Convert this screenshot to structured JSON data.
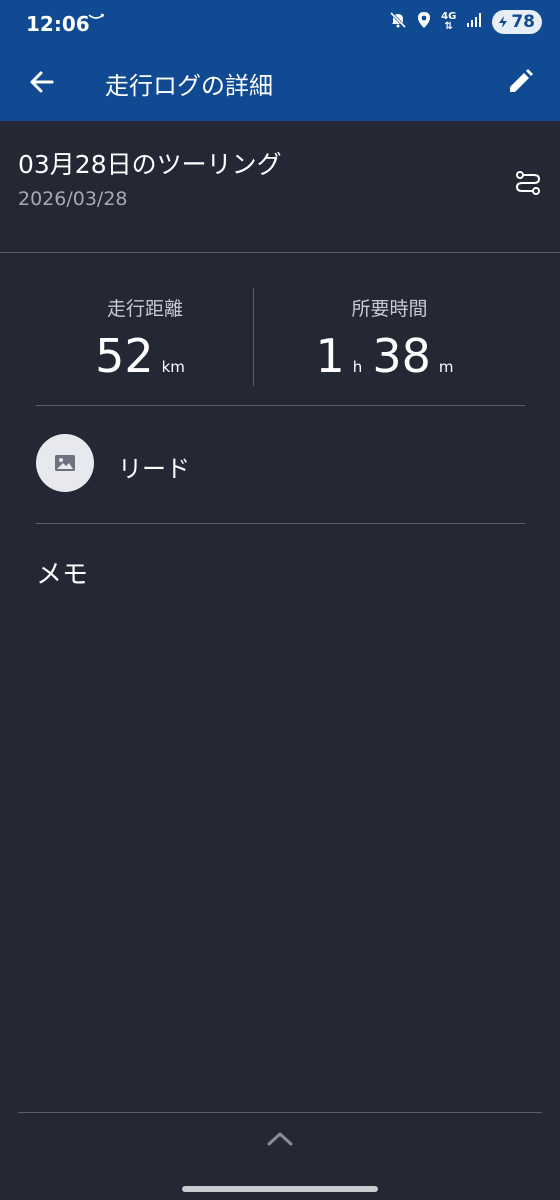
{
  "status_bar": {
    "time": "12:06",
    "network": "4G",
    "battery": "78",
    "icons": [
      "amazon-smile-icon",
      "mute-icon",
      "location-icon",
      "signal-icon",
      "battery-icon"
    ]
  },
  "app_bar": {
    "title": "走行ログの詳細",
    "back_icon": "arrow-back-icon",
    "edit_icon": "pencil-icon"
  },
  "log": {
    "title": "03月28日のツーリング",
    "date": "2026/03/28",
    "route_icon": "route-icon"
  },
  "stats": {
    "distance": {
      "label": "走行距離",
      "value": "52",
      "unit": "km"
    },
    "duration": {
      "label": "所要時間",
      "hours": "1",
      "hours_unit": "h",
      "minutes": "38",
      "minutes_unit": "m"
    }
  },
  "rider": {
    "name": "リード",
    "avatar_icon": "image-placeholder-icon"
  },
  "memo": {
    "label": "メモ"
  },
  "bottom": {
    "expand_icon": "chevron-up-icon"
  },
  "colors": {
    "app_bar": "#0f4a92",
    "background": "#242834",
    "divider": "#5a5f6b",
    "secondary_text": "#a5a9b3"
  }
}
